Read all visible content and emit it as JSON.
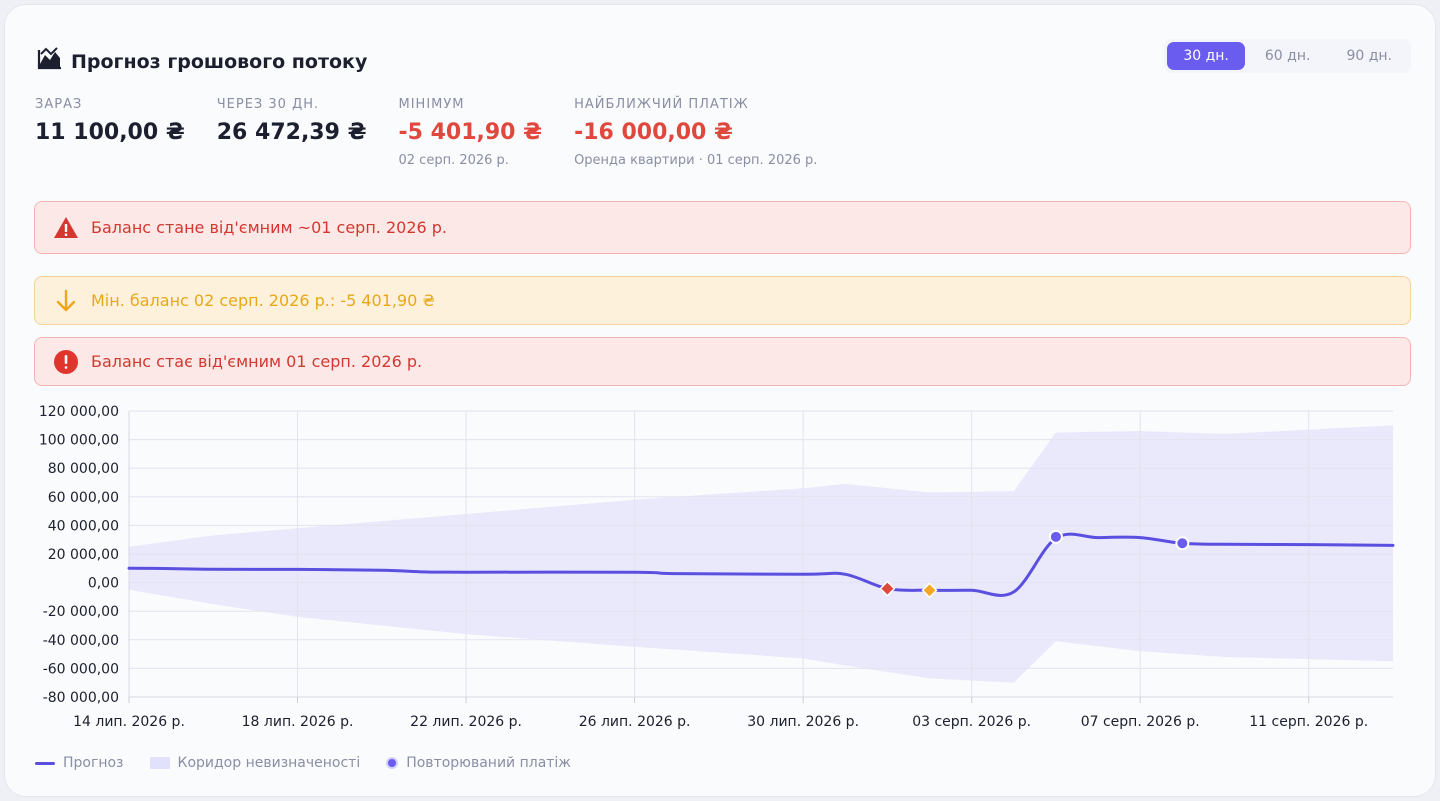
{
  "header": {
    "title": "Прогноз грошового потоку",
    "icon": "chart-area-icon"
  },
  "periods": [
    {
      "label": "30 дн.",
      "active": true
    },
    {
      "label": "60 дн.",
      "active": false
    },
    {
      "label": "90 дн.",
      "active": false
    }
  ],
  "stats": [
    {
      "label": "ЗАРАЗ",
      "value": "11 100,00 ₴",
      "sub": "",
      "negative": false
    },
    {
      "label": "ЧЕРЕЗ 30 ДН.",
      "value": "26 472,39 ₴",
      "sub": "",
      "negative": false
    },
    {
      "label": "МІНІМУМ",
      "value": "-5 401,90 ₴",
      "sub": "02 серп. 2026 р.",
      "negative": true
    },
    {
      "label": "НАЙБЛИЖЧИЙ ПЛАТІЖ",
      "value": "-16 000,00 ₴",
      "sub": "Оренда квартири · 01 серп. 2026 р.",
      "negative": true
    }
  ],
  "alerts": [
    {
      "text": "Баланс стане від'ємним ~01 серп. 2026 р.",
      "kind": "red",
      "icon": "warning-triangle-icon"
    },
    {
      "text": "Мін. баланс 02 серп. 2026 р.: -5 401,90 ₴",
      "kind": "yellow",
      "icon": "arrow-down-icon"
    },
    {
      "text": "Баланс стає від'ємним 01 серп. 2026 р.",
      "kind": "red",
      "icon": "error-circle-icon"
    }
  ],
  "legend": {
    "forecast": "Прогноз",
    "band": "Коридор невизначеності",
    "recurring": "Повторюваний платіж"
  },
  "colors": {
    "accent": "#6b5cf0",
    "line": "#5b4fe0",
    "band": "#e2e1fb",
    "negative": "#e0483e",
    "warning": "#f5a623"
  },
  "chart_data": {
    "type": "line",
    "ylim": [
      -80000,
      120000
    ],
    "yticks": [
      120000,
      100000,
      80000,
      60000,
      40000,
      20000,
      0,
      -20000,
      -40000,
      -60000,
      -80000
    ],
    "ytick_labels": [
      "120 000,00",
      "100 000,00",
      "80 000,00",
      "60 000,00",
      "40 000,00",
      "20 000,00",
      "0,00",
      "-20 000,00",
      "-40 000,00",
      "-60 000,00",
      "-80 000,00"
    ],
    "xlim": [
      "2026-07-14",
      "2026-08-13"
    ],
    "xticks": [
      "2026-07-14",
      "2026-07-18",
      "2026-07-22",
      "2026-07-26",
      "2026-07-30",
      "2026-08-03",
      "2026-08-07",
      "2026-08-11"
    ],
    "xtick_labels": [
      "14 лип. 2026 р.",
      "18 лип. 2026 р.",
      "22 лип. 2026 р.",
      "26 лип. 2026 р.",
      "30 лип. 2026 р.",
      "03 серп. 2026 р.",
      "07 серп. 2026 р.",
      "11 серп. 2026 р."
    ],
    "series": [
      {
        "name": "Прогноз",
        "x": [
          "2026-07-14",
          "2026-07-15",
          "2026-07-16",
          "2026-07-18",
          "2026-07-20",
          "2026-07-21",
          "2026-07-22",
          "2026-07-26",
          "2026-07-27",
          "2026-07-30",
          "2026-07-31",
          "2026-08-01",
          "2026-08-02",
          "2026-08-03",
          "2026-08-04",
          "2026-08-05",
          "2026-08-06",
          "2026-08-07",
          "2026-08-08",
          "2026-08-09",
          "2026-08-11",
          "2026-08-13"
        ],
        "y": [
          10000,
          9800,
          9300,
          9200,
          8700,
          7500,
          7300,
          7200,
          6300,
          5800,
          5800,
          -4200,
          -5400,
          -5400,
          -6500,
          31000,
          31500,
          31500,
          27500,
          26800,
          26600,
          26000
        ]
      },
      {
        "name": "Коридор невизначеності (верх)",
        "x": [
          "2026-07-14",
          "2026-07-16",
          "2026-07-18",
          "2026-07-20",
          "2026-07-22",
          "2026-07-26",
          "2026-07-30",
          "2026-07-31",
          "2026-08-02",
          "2026-08-04",
          "2026-08-05",
          "2026-08-07",
          "2026-08-09",
          "2026-08-13"
        ],
        "y": [
          25000,
          33000,
          38000,
          43000,
          48000,
          58000,
          66000,
          69000,
          63000,
          64000,
          105000,
          106000,
          104000,
          110000
        ]
      },
      {
        "name": "Коридор невизначеності (низ)",
        "x": [
          "2026-07-14",
          "2026-07-16",
          "2026-07-18",
          "2026-07-20",
          "2026-07-22",
          "2026-07-26",
          "2026-07-30",
          "2026-07-31",
          "2026-08-02",
          "2026-08-04",
          "2026-08-05",
          "2026-08-07",
          "2026-08-09",
          "2026-08-13"
        ],
        "y": [
          -5000,
          -15000,
          -24000,
          -30000,
          -36000,
          -45000,
          -53000,
          -58000,
          -67000,
          -70000,
          -41000,
          -48000,
          -52000,
          -55000
        ]
      }
    ],
    "markers": [
      {
        "x": "2026-08-01",
        "y": -4200,
        "shape": "diamond",
        "color": "#e0483e"
      },
      {
        "x": "2026-08-02",
        "y": -5400,
        "shape": "diamond",
        "color": "#f5a623"
      },
      {
        "x": "2026-08-05",
        "y": 32000,
        "shape": "circle",
        "color": "#6b5cf0"
      },
      {
        "x": "2026-08-08",
        "y": 27500,
        "shape": "circle",
        "color": "#6b5cf0"
      }
    ],
    "grid": true,
    "legend_position": "bottom-left"
  }
}
